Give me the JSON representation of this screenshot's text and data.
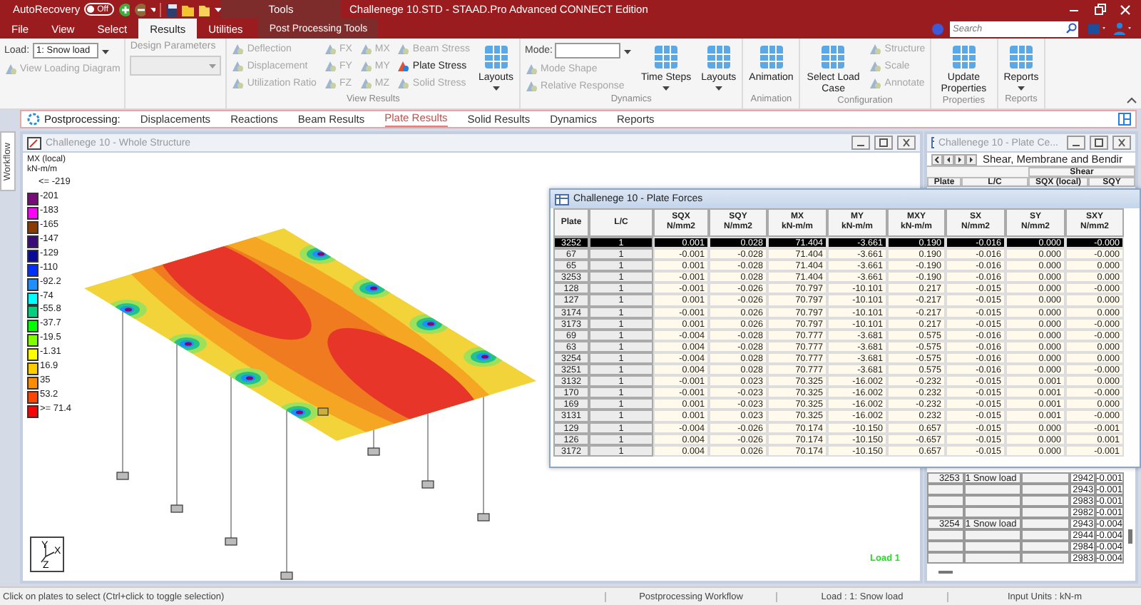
{
  "title_bar": {
    "autorecovery_label": "AutoRecovery",
    "autorecovery_toggle": {
      "label": "Off",
      "on": false
    },
    "context_header": "Tools",
    "title": "Challenege 10.STD - STAAD.Pro Advanced CONNECT Edition"
  },
  "menu_tabs": [
    {
      "label": "File",
      "selected": false,
      "kind": "normal"
    },
    {
      "label": "View",
      "selected": false,
      "kind": "normal"
    },
    {
      "label": "Select",
      "selected": false,
      "kind": "normal"
    },
    {
      "label": "Results",
      "selected": true,
      "kind": "normal"
    },
    {
      "label": "Utilities",
      "selected": false,
      "kind": "normal"
    },
    {
      "label": "Post Processing Tools",
      "selected": false,
      "kind": "contextual"
    }
  ],
  "search": {
    "placeholder": "Search"
  },
  "ribbon": {
    "groups": [
      {
        "items": [
          {
            "kind": "column",
            "buttons": [
              {
                "kind": "field",
                "label": "Load:",
                "value": "1: Snow load"
              },
              {
                "kind": "button",
                "label": "View Loading Diagram",
                "disabled": true
              }
            ]
          }
        ]
      },
      {
        "items": [
          {
            "kind": "column",
            "buttons": [
              {
                "kind": "stacked_field",
                "label": "Design Parameters",
                "disabled": true
              }
            ]
          }
        ]
      },
      {
        "label": "View Results",
        "items": [
          {
            "kind": "column",
            "buttons": [
              {
                "kind": "button",
                "label": "Deflection",
                "disabled": true
              },
              {
                "kind": "button",
                "label": "Displacement",
                "disabled": true
              },
              {
                "kind": "button",
                "label": "Utilization Ratio",
                "disabled": true
              }
            ]
          },
          {
            "kind": "column",
            "buttons": [
              {
                "kind": "button",
                "label": "FX",
                "disabled": true
              },
              {
                "kind": "button",
                "label": "FY",
                "disabled": true
              },
              {
                "kind": "button",
                "label": "FZ",
                "disabled": true
              }
            ]
          },
          {
            "kind": "column",
            "buttons": [
              {
                "kind": "button",
                "label": "MX",
                "disabled": true
              },
              {
                "kind": "button",
                "label": "MY",
                "disabled": true
              },
              {
                "kind": "button",
                "label": "MZ",
                "disabled": true
              }
            ]
          },
          {
            "kind": "column",
            "buttons": [
              {
                "kind": "button",
                "label": "Beam Stress",
                "disabled": true
              },
              {
                "kind": "button",
                "label": "Plate Stress",
                "disabled": false
              },
              {
                "kind": "button",
                "label": "Solid Stress",
                "disabled": true
              }
            ]
          },
          {
            "kind": "large",
            "label": "Layouts",
            "disabled": false,
            "dropdown": true
          }
        ]
      },
      {
        "label": "Dynamics",
        "items": [
          {
            "kind": "column",
            "buttons": [
              {
                "kind": "field",
                "label": "Mode:"
              },
              {
                "kind": "button",
                "label": "Mode Shape",
                "disabled": true
              },
              {
                "kind": "button",
                "label": "Relative Response",
                "disabled": true
              }
            ]
          },
          {
            "kind": "large",
            "label": "Time Steps",
            "disabled": false,
            "dropdown": true
          },
          {
            "kind": "large",
            "label": "Layouts",
            "disabled": false,
            "dropdown": true
          }
        ]
      },
      {
        "label": "Animation",
        "items": [
          {
            "kind": "large",
            "label": "Animation",
            "disabled": false,
            "dropdown": false
          }
        ]
      },
      {
        "label": "Configuration",
        "items": [
          {
            "kind": "large",
            "label": "Select Load Case",
            "disabled": false,
            "dropdown": false
          },
          {
            "kind": "column",
            "buttons": [
              {
                "kind": "button",
                "label": "Structure",
                "disabled": true
              },
              {
                "kind": "button",
                "label": "Scale",
                "disabled": true
              },
              {
                "kind": "button",
                "label": "Annotate",
                "disabled": true
              }
            ]
          }
        ]
      },
      {
        "label": "Properties",
        "items": [
          {
            "kind": "large",
            "label": "Update Properties",
            "disabled": false,
            "dropdown": false
          }
        ]
      },
      {
        "label": "Reports",
        "items": [
          {
            "kind": "large",
            "label": "Reports",
            "disabled": false,
            "dropdown": true
          }
        ]
      }
    ]
  },
  "workflow": {
    "side_tab": "Workflow",
    "label": "Postprocessing:",
    "tabs": [
      {
        "label": "Displacements",
        "selected": false
      },
      {
        "label": "Reactions",
        "selected": false
      },
      {
        "label": "Beam Results",
        "selected": false
      },
      {
        "label": "Plate Results",
        "selected": true
      },
      {
        "label": "Solid Results",
        "selected": false
      },
      {
        "label": "Dynamics",
        "selected": false
      },
      {
        "label": "Reports",
        "selected": false
      }
    ]
  },
  "structure_window": {
    "title": "Challenege 10 - Whole Structure",
    "legend": {
      "title": "MX (local)",
      "unit": "kN-m/m",
      "min_label": "<= -219",
      "items": [
        {
          "label": "-201",
          "color": "#7a0a7a"
        },
        {
          "label": "-183",
          "color": "#ff00ff"
        },
        {
          "label": "-165",
          "color": "#8b3a00"
        },
        {
          "label": "-147",
          "color": "#3a0a7a"
        },
        {
          "label": "-129",
          "color": "#0a0a9a"
        },
        {
          "label": "-110",
          "color": "#0030ff"
        },
        {
          "label": "-92.2",
          "color": "#1e8fff"
        },
        {
          "label": "-74",
          "color": "#00ffff"
        },
        {
          "label": "-55.8",
          "color": "#00d080"
        },
        {
          "label": "-37.7",
          "color": "#00ff00"
        },
        {
          "label": "-19.5",
          "color": "#80ff00"
        },
        {
          "label": "-1.31",
          "color": "#ffff00"
        },
        {
          "label": "16.9",
          "color": "#ffcc00"
        },
        {
          "label": "35",
          "color": "#ff8c00"
        },
        {
          "label": "53.2",
          "color": "#ff4500"
        },
        {
          "label": ">= 71.4",
          "color": "#ff0000"
        }
      ]
    },
    "axis_labels": [
      "Y",
      "X",
      "Z"
    ],
    "load_label": "Load 1"
  },
  "plate_forces_window": {
    "title": "Challenege 10 - Plate Forces",
    "columns": [
      {
        "name": "Plate"
      },
      {
        "name": "L/C"
      },
      {
        "name": "SQX",
        "unit": "N/mm2"
      },
      {
        "name": "SQY",
        "unit": "N/mm2"
      },
      {
        "name": "MX",
        "unit": "kN-m/m"
      },
      {
        "name": "MY",
        "unit": "kN-m/m"
      },
      {
        "name": "MXY",
        "unit": "kN-m/m"
      },
      {
        "name": "SX",
        "unit": "N/mm2"
      },
      {
        "name": "SY",
        "unit": "N/mm2"
      },
      {
        "name": "SXY",
        "unit": "N/mm2"
      }
    ],
    "rows": [
      {
        "selected": true,
        "cells": [
          "3252",
          "1",
          "0.001",
          "0.028",
          "71.404",
          "-3.661",
          "0.190",
          "-0.016",
          "0.000",
          "-0.000"
        ]
      },
      {
        "selected": false,
        "cells": [
          "67",
          "1",
          "-0.001",
          "-0.028",
          "71.404",
          "-3.661",
          "0.190",
          "-0.016",
          "0.000",
          "-0.000"
        ]
      },
      {
        "selected": false,
        "cells": [
          "65",
          "1",
          "0.001",
          "-0.028",
          "71.404",
          "-3.661",
          "-0.190",
          "-0.016",
          "0.000",
          "0.000"
        ]
      },
      {
        "selected": false,
        "cells": [
          "3253",
          "1",
          "-0.001",
          "0.028",
          "71.404",
          "-3.661",
          "-0.190",
          "-0.016",
          "0.000",
          "0.000"
        ]
      },
      {
        "selected": false,
        "cells": [
          "128",
          "1",
          "-0.001",
          "-0.026",
          "70.797",
          "-10.101",
          "0.217",
          "-0.015",
          "0.000",
          "-0.000"
        ]
      },
      {
        "selected": false,
        "cells": [
          "127",
          "1",
          "0.001",
          "-0.026",
          "70.797",
          "-10.101",
          "-0.217",
          "-0.015",
          "0.000",
          "0.000"
        ]
      },
      {
        "selected": false,
        "cells": [
          "3174",
          "1",
          "-0.001",
          "0.026",
          "70.797",
          "-10.101",
          "-0.217",
          "-0.015",
          "0.000",
          "0.000"
        ]
      },
      {
        "selected": false,
        "cells": [
          "3173",
          "1",
          "0.001",
          "0.026",
          "70.797",
          "-10.101",
          "0.217",
          "-0.015",
          "0.000",
          "-0.000"
        ]
      },
      {
        "selected": false,
        "cells": [
          "69",
          "1",
          "-0.004",
          "-0.028",
          "70.777",
          "-3.681",
          "0.575",
          "-0.016",
          "0.000",
          "-0.000"
        ]
      },
      {
        "selected": false,
        "cells": [
          "63",
          "1",
          "0.004",
          "-0.028",
          "70.777",
          "-3.681",
          "-0.575",
          "-0.016",
          "0.000",
          "0.000"
        ]
      },
      {
        "selected": false,
        "cells": [
          "3254",
          "1",
          "-0.004",
          "0.028",
          "70.777",
          "-3.681",
          "-0.575",
          "-0.016",
          "0.000",
          "0.000"
        ]
      },
      {
        "selected": false,
        "cells": [
          "3251",
          "1",
          "0.004",
          "0.028",
          "70.777",
          "-3.681",
          "0.575",
          "-0.016",
          "0.000",
          "-0.000"
        ]
      },
      {
        "selected": false,
        "cells": [
          "3132",
          "1",
          "-0.001",
          "0.023",
          "70.325",
          "-16.002",
          "-0.232",
          "-0.015",
          "0.001",
          "0.000"
        ]
      },
      {
        "selected": false,
        "cells": [
          "170",
          "1",
          "-0.001",
          "-0.023",
          "70.325",
          "-16.002",
          "0.232",
          "-0.015",
          "0.001",
          "-0.000"
        ]
      },
      {
        "selected": false,
        "cells": [
          "169",
          "1",
          "0.001",
          "-0.023",
          "70.325",
          "-16.002",
          "-0.232",
          "-0.015",
          "0.001",
          "0.000"
        ]
      },
      {
        "selected": false,
        "cells": [
          "3131",
          "1",
          "0.001",
          "0.023",
          "70.325",
          "-16.002",
          "0.232",
          "-0.015",
          "0.001",
          "-0.000"
        ]
      },
      {
        "selected": false,
        "cells": [
          "129",
          "1",
          "-0.004",
          "-0.026",
          "70.174",
          "-10.150",
          "0.657",
          "-0.015",
          "0.000",
          "-0.001"
        ]
      },
      {
        "selected": false,
        "cells": [
          "126",
          "1",
          "0.004",
          "-0.026",
          "70.174",
          "-10.150",
          "-0.657",
          "-0.015",
          "0.000",
          "0.001"
        ]
      },
      {
        "selected": false,
        "cells": [
          "3172",
          "1",
          "0.004",
          "0.026",
          "70.174",
          "-10.150",
          "0.657",
          "-0.015",
          "0.000",
          "-0.001"
        ]
      }
    ]
  },
  "plate_centre_window": {
    "title": "Challenege 10 - Plate Ce...",
    "sheet_tab": "Shear, Membrane and Bendir",
    "group_header": "Shear",
    "columns": [
      "Plate",
      "L/C",
      "SQX (local)",
      "SQY"
    ],
    "rows": [
      {
        "plate": "3253",
        "load": "1 Snow load",
        "node": "2942",
        "value": "-0.001"
      },
      {
        "node": "2943",
        "value": "-0.001"
      },
      {
        "node": "2983",
        "value": "-0.001"
      },
      {
        "node": "2982",
        "value": "-0.001"
      },
      {
        "plate": "3254",
        "load": "1 Snow load",
        "node": "2943",
        "value": "-0.004"
      },
      {
        "node": "2944",
        "value": "-0.004"
      },
      {
        "node": "2984",
        "value": "-0.004"
      },
      {
        "node": "2983",
        "value": "-0.004"
      }
    ]
  },
  "status_bar": [
    "Click on plates to select (Ctrl+click to toggle selection)",
    "Postprocessing Workflow",
    "Load : 1: Snow load",
    "Input Units : kN-m"
  ]
}
